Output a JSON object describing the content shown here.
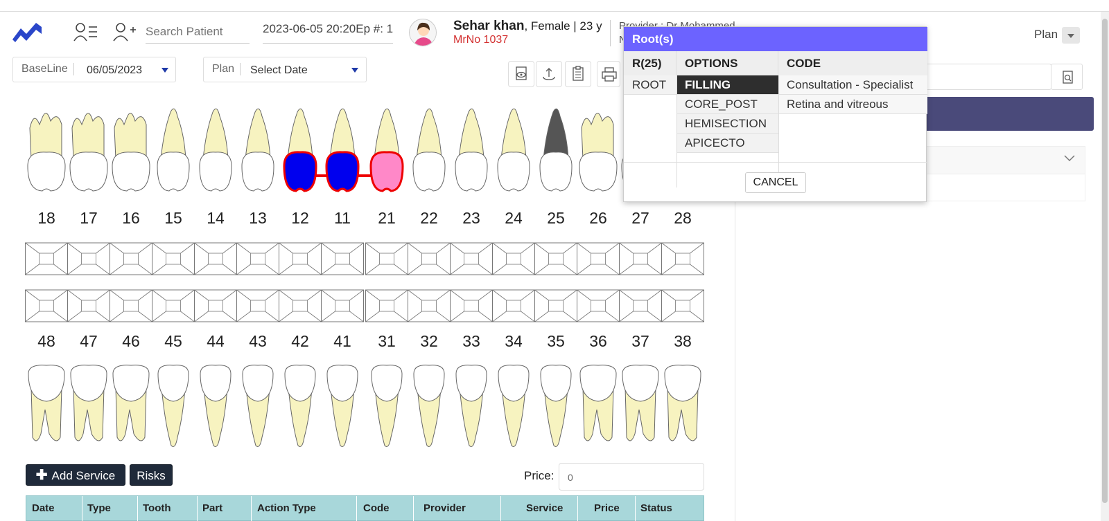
{
  "header": {
    "search_placeholder": "Search Patient",
    "episode": "2023-06-05 20:20Ep #: 1",
    "patient_name": "Sehar khan",
    "patient_info": ", Female | 23 y",
    "mrno": "MrNo 1037",
    "provider": "Provider : Dr Mohammed",
    "provider_line2": "N",
    "plan_label": "Plan"
  },
  "filters": {
    "baseline_label": "BaseLine",
    "baseline_value": "06/05/2023",
    "plan_label": "Plan",
    "plan_value": "Select Date"
  },
  "upper_teeth": [
    "18",
    "17",
    "16",
    "15",
    "14",
    "13",
    "12",
    "11",
    "21",
    "22",
    "23",
    "24",
    "25",
    "26",
    "27",
    "28"
  ],
  "lower_teeth": [
    "48",
    "47",
    "46",
    "45",
    "44",
    "43",
    "42",
    "41",
    "31",
    "32",
    "33",
    "34",
    "35",
    "36",
    "37",
    "38"
  ],
  "tooth_marks": {
    "12": {
      "crown_fill": "#0000ee",
      "outline": "#ee0000"
    },
    "11": {
      "crown_fill": "#0000ee",
      "outline": "#ee0000"
    },
    "21": {
      "crown_fill": "#ff88c8",
      "outline": "#ee0000"
    },
    "25": {
      "root_fill": "#555555"
    }
  },
  "bridge_color": "#ee0000",
  "actions": {
    "add_service": "Add Service",
    "risks": "Risks",
    "price_label": "Price:",
    "price_value": "0"
  },
  "table": {
    "columns": [
      "Date",
      "Type",
      "Tooth",
      "Part",
      "Action Type",
      "Code",
      "Provider",
      "Service",
      "Price",
      "Status"
    ]
  },
  "modal": {
    "title": "Root(s)",
    "col1_header": "R(25)",
    "col2_header": "OPTIONS",
    "col3_header": "CODE",
    "roots": [
      "ROOT"
    ],
    "options": [
      "FILLING",
      "CORE_POST",
      "HEMISECTION",
      "APICECTO"
    ],
    "selected_option": "FILLING",
    "codes": [
      "Consultation - Specialist",
      "Retina and vitreous"
    ],
    "cancel": "CANCEL"
  },
  "colors": {
    "accent": "#6c63ff",
    "logo": "#1f3aa8",
    "table_header": "#a8d7da",
    "dark_button": "#1f2a3a"
  }
}
